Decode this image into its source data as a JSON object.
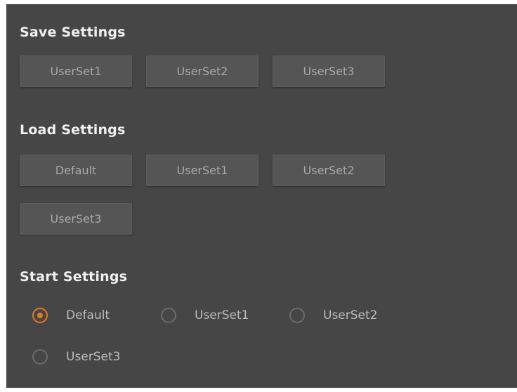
{
  "save": {
    "title": "Save Settings",
    "buttons": [
      "UserSet1",
      "UserSet2",
      "UserSet3"
    ]
  },
  "load": {
    "title": "Load Settings",
    "buttons": [
      "Default",
      "UserSet1",
      "UserSet2",
      "UserSet3"
    ]
  },
  "start": {
    "title": "Start Settings",
    "options": [
      "Default",
      "UserSet1",
      "UserSet2",
      "UserSet3"
    ],
    "selected": "Default"
  },
  "colors": {
    "panel_bg": "#464646",
    "button_bg": "#555555",
    "accent": "#e8791f"
  }
}
